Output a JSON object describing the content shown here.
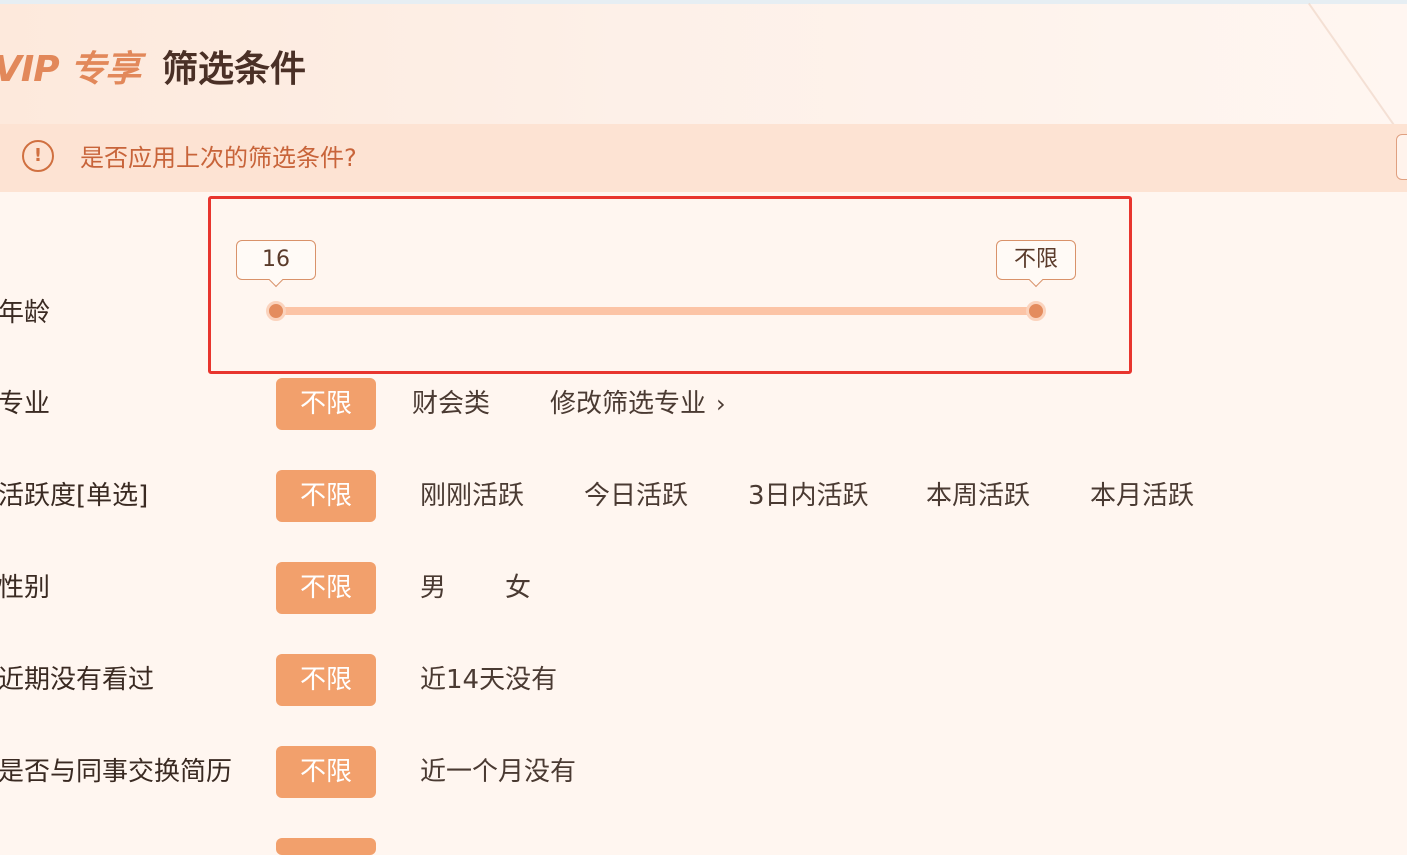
{
  "header": {
    "vip_label": "VIP 专享",
    "title": "筛选条件"
  },
  "notice": {
    "icon": "exclamation-circle-icon",
    "text": "是否应用上次的筛选条件?"
  },
  "age": {
    "label": "年龄",
    "min_label": "16",
    "max_label": "不限",
    "range_min_fraction": 0,
    "range_max_fraction": 1
  },
  "major": {
    "label": "专业",
    "selected": "不限",
    "options": [
      "财会类"
    ],
    "edit_link": "修改筛选专业"
  },
  "activity": {
    "label": "活跃度[单选]",
    "selected": "不限",
    "options": [
      "刚刚活跃",
      "今日活跃",
      "3日内活跃",
      "本周活跃",
      "本月活跃"
    ]
  },
  "gender": {
    "label": "性别",
    "selected": "不限",
    "options": [
      "男",
      "女"
    ]
  },
  "recently_viewed": {
    "label": "近期没有看过",
    "selected": "不限",
    "options": [
      "近14天没有"
    ]
  },
  "exchanged_resume": {
    "label": "是否与同事交换简历",
    "selected": "不限",
    "options": [
      "近一个月没有"
    ]
  },
  "colors": {
    "accent": "#f2a06c",
    "slider_track": "#fcc4a6",
    "slider_knob": "#e48c5e",
    "highlight_box": "#e8352e",
    "notice_bg": "#fde3d3",
    "notice_text": "#c8643a",
    "vip_text": "#e2885a"
  }
}
